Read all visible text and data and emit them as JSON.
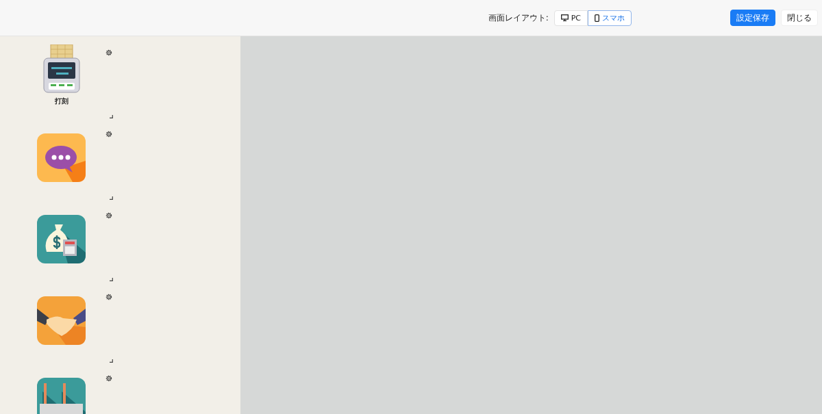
{
  "header": {
    "layout_label": "画面レイアウト:",
    "layout_options": [
      {
        "kind": "pc",
        "label": "PC",
        "selected": false
      },
      {
        "kind": "phone",
        "label": "スマホ",
        "selected": true
      }
    ],
    "buttons": [
      {
        "kind": "primary",
        "label": "設定保存"
      },
      {
        "kind": "plain",
        "label": "閉じる"
      }
    ]
  },
  "widgets": [
    {
      "kind": "clock",
      "label": "打刻"
    },
    {
      "kind": "chat"
    },
    {
      "kind": "money"
    },
    {
      "kind": "handshake"
    },
    {
      "kind": "factory"
    }
  ]
}
